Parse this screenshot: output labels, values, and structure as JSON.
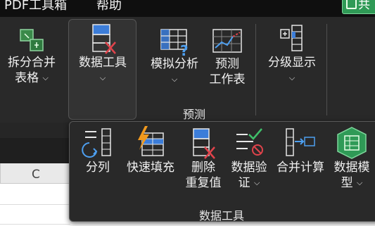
{
  "menubar": {
    "items": [
      "PDF工具箱",
      "帮助"
    ],
    "share_label": "共"
  },
  "ribbon": {
    "split_merge_table": {
      "label1": "拆分合并",
      "label2": "表格"
    },
    "data_tools": {
      "label": "数据工具"
    },
    "what_if": {
      "label": "模拟分析"
    },
    "forecast_sheet": {
      "label1": "预测",
      "label2": "工作表"
    },
    "outline": {
      "label": "分级显示"
    },
    "group_forecast": "预测"
  },
  "sheet": {
    "column_letter": "C"
  },
  "popup": {
    "group_label": "数据工具",
    "items": [
      {
        "label1": "分列",
        "label2": ""
      },
      {
        "label1": "快速填充",
        "label2": ""
      },
      {
        "label1": "删除",
        "label2": "重复值"
      },
      {
        "label1": "数据验",
        "label2": "证"
      },
      {
        "label1": "合并计算",
        "label2": ""
      },
      {
        "label1": "数据模",
        "label2": "型"
      }
    ]
  },
  "colors": {
    "accent_blue": "#3c7dd9",
    "accent_red": "#e0434b",
    "accent_green": "#2f9a56",
    "bolt_orange": "#f29a1e"
  }
}
